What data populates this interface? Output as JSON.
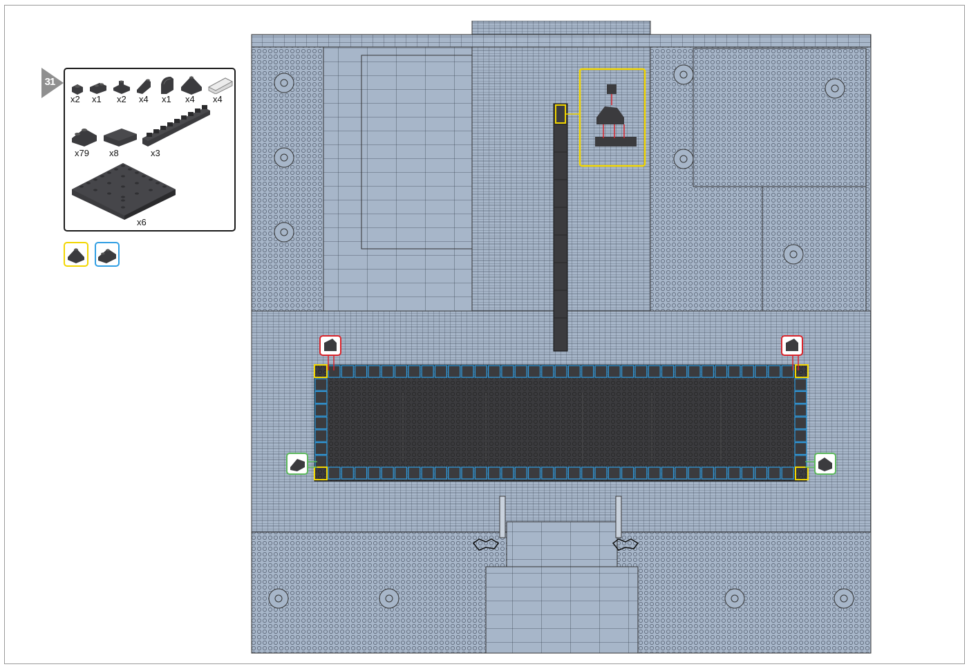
{
  "step": {
    "number": "31"
  },
  "parts_list": [
    {
      "icon": "brick-1x1-icon",
      "qty": "x2"
    },
    {
      "icon": "brick-1x2-icon",
      "qty": "x1"
    },
    {
      "icon": "plate-1x2-icon",
      "qty": "x2"
    },
    {
      "icon": "slope-1x2-icon",
      "qty": "x4"
    },
    {
      "icon": "curved-slope-icon",
      "qty": "x1"
    },
    {
      "icon": "corner-slope-icon",
      "qty": "x4"
    },
    {
      "icon": "light-bluish-gray-tile-icon",
      "qty": "x4"
    },
    {
      "icon": "cheese-slope-icon",
      "qty": "x79"
    },
    {
      "icon": "tile-2x4-icon",
      "qty": "x8"
    },
    {
      "icon": "plate-1x10-icon",
      "qty": "x3"
    },
    {
      "icon": "baseplate-8x8-icon",
      "qty": "x6"
    }
  ],
  "highlight_chips": [
    {
      "icon": "corner-slope-yellow-icon",
      "color": "#f2d600"
    },
    {
      "icon": "cheese-slope-blue-icon",
      "color": "#2f9ee3"
    }
  ],
  "colors": {
    "baseplate": "#a7b6c9",
    "dark_part": "#3b3b3e",
    "yellow_highlight": "#f2d600",
    "blue_highlight": "#2f9ee3",
    "red_highlight": "#d9232a",
    "green_highlight": "#5cb85c"
  }
}
